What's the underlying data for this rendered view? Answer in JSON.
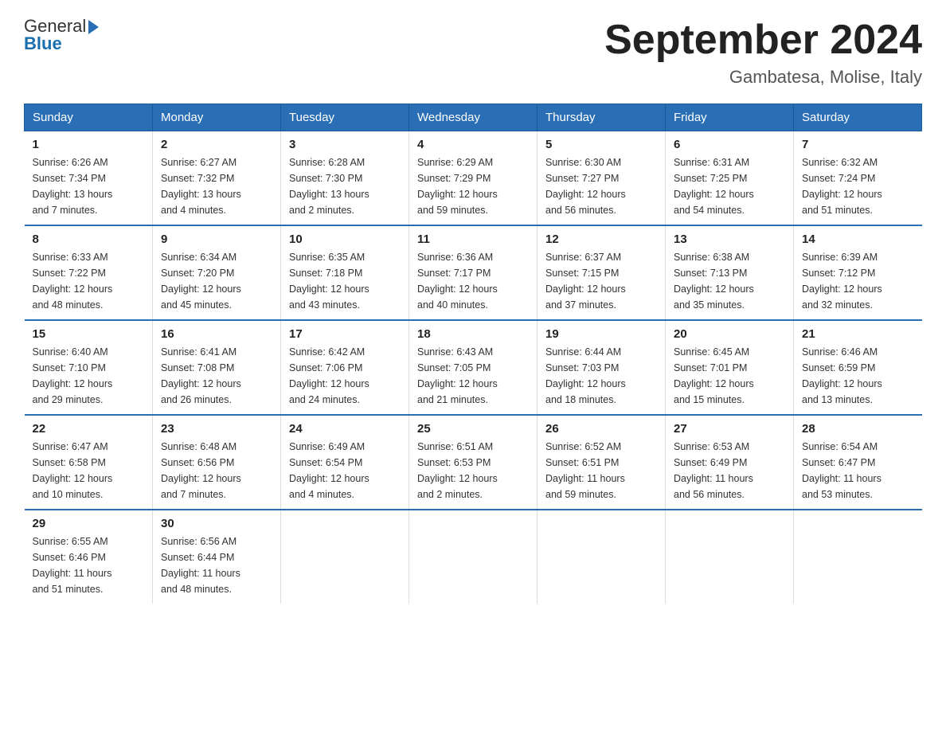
{
  "logo": {
    "general": "General",
    "blue": "Blue",
    "triangle": "▶"
  },
  "title": "September 2024",
  "location": "Gambatesa, Molise, Italy",
  "days_of_week": [
    "Sunday",
    "Monday",
    "Tuesday",
    "Wednesday",
    "Thursday",
    "Friday",
    "Saturday"
  ],
  "weeks": [
    [
      {
        "day": "1",
        "sunrise": "6:26 AM",
        "sunset": "7:34 PM",
        "daylight": "13 hours and 7 minutes."
      },
      {
        "day": "2",
        "sunrise": "6:27 AM",
        "sunset": "7:32 PM",
        "daylight": "13 hours and 4 minutes."
      },
      {
        "day": "3",
        "sunrise": "6:28 AM",
        "sunset": "7:30 PM",
        "daylight": "13 hours and 2 minutes."
      },
      {
        "day": "4",
        "sunrise": "6:29 AM",
        "sunset": "7:29 PM",
        "daylight": "12 hours and 59 minutes."
      },
      {
        "day": "5",
        "sunrise": "6:30 AM",
        "sunset": "7:27 PM",
        "daylight": "12 hours and 56 minutes."
      },
      {
        "day": "6",
        "sunrise": "6:31 AM",
        "sunset": "7:25 PM",
        "daylight": "12 hours and 54 minutes."
      },
      {
        "day": "7",
        "sunrise": "6:32 AM",
        "sunset": "7:24 PM",
        "daylight": "12 hours and 51 minutes."
      }
    ],
    [
      {
        "day": "8",
        "sunrise": "6:33 AM",
        "sunset": "7:22 PM",
        "daylight": "12 hours and 48 minutes."
      },
      {
        "day": "9",
        "sunrise": "6:34 AM",
        "sunset": "7:20 PM",
        "daylight": "12 hours and 45 minutes."
      },
      {
        "day": "10",
        "sunrise": "6:35 AM",
        "sunset": "7:18 PM",
        "daylight": "12 hours and 43 minutes."
      },
      {
        "day": "11",
        "sunrise": "6:36 AM",
        "sunset": "7:17 PM",
        "daylight": "12 hours and 40 minutes."
      },
      {
        "day": "12",
        "sunrise": "6:37 AM",
        "sunset": "7:15 PM",
        "daylight": "12 hours and 37 minutes."
      },
      {
        "day": "13",
        "sunrise": "6:38 AM",
        "sunset": "7:13 PM",
        "daylight": "12 hours and 35 minutes."
      },
      {
        "day": "14",
        "sunrise": "6:39 AM",
        "sunset": "7:12 PM",
        "daylight": "12 hours and 32 minutes."
      }
    ],
    [
      {
        "day": "15",
        "sunrise": "6:40 AM",
        "sunset": "7:10 PM",
        "daylight": "12 hours and 29 minutes."
      },
      {
        "day": "16",
        "sunrise": "6:41 AM",
        "sunset": "7:08 PM",
        "daylight": "12 hours and 26 minutes."
      },
      {
        "day": "17",
        "sunrise": "6:42 AM",
        "sunset": "7:06 PM",
        "daylight": "12 hours and 24 minutes."
      },
      {
        "day": "18",
        "sunrise": "6:43 AM",
        "sunset": "7:05 PM",
        "daylight": "12 hours and 21 minutes."
      },
      {
        "day": "19",
        "sunrise": "6:44 AM",
        "sunset": "7:03 PM",
        "daylight": "12 hours and 18 minutes."
      },
      {
        "day": "20",
        "sunrise": "6:45 AM",
        "sunset": "7:01 PM",
        "daylight": "12 hours and 15 minutes."
      },
      {
        "day": "21",
        "sunrise": "6:46 AM",
        "sunset": "6:59 PM",
        "daylight": "12 hours and 13 minutes."
      }
    ],
    [
      {
        "day": "22",
        "sunrise": "6:47 AM",
        "sunset": "6:58 PM",
        "daylight": "12 hours and 10 minutes."
      },
      {
        "day": "23",
        "sunrise": "6:48 AM",
        "sunset": "6:56 PM",
        "daylight": "12 hours and 7 minutes."
      },
      {
        "day": "24",
        "sunrise": "6:49 AM",
        "sunset": "6:54 PM",
        "daylight": "12 hours and 4 minutes."
      },
      {
        "day": "25",
        "sunrise": "6:51 AM",
        "sunset": "6:53 PM",
        "daylight": "12 hours and 2 minutes."
      },
      {
        "day": "26",
        "sunrise": "6:52 AM",
        "sunset": "6:51 PM",
        "daylight": "11 hours and 59 minutes."
      },
      {
        "day": "27",
        "sunrise": "6:53 AM",
        "sunset": "6:49 PM",
        "daylight": "11 hours and 56 minutes."
      },
      {
        "day": "28",
        "sunrise": "6:54 AM",
        "sunset": "6:47 PM",
        "daylight": "11 hours and 53 minutes."
      }
    ],
    [
      {
        "day": "29",
        "sunrise": "6:55 AM",
        "sunset": "6:46 PM",
        "daylight": "11 hours and 51 minutes."
      },
      {
        "day": "30",
        "sunrise": "6:56 AM",
        "sunset": "6:44 PM",
        "daylight": "11 hours and 48 minutes."
      },
      {
        "day": "",
        "sunrise": "",
        "sunset": "",
        "daylight": ""
      },
      {
        "day": "",
        "sunrise": "",
        "sunset": "",
        "daylight": ""
      },
      {
        "day": "",
        "sunrise": "",
        "sunset": "",
        "daylight": ""
      },
      {
        "day": "",
        "sunrise": "",
        "sunset": "",
        "daylight": ""
      },
      {
        "day": "",
        "sunrise": "",
        "sunset": "",
        "daylight": ""
      }
    ]
  ],
  "labels": {
    "sunrise": "Sunrise:",
    "sunset": "Sunset:",
    "daylight": "Daylight:"
  }
}
